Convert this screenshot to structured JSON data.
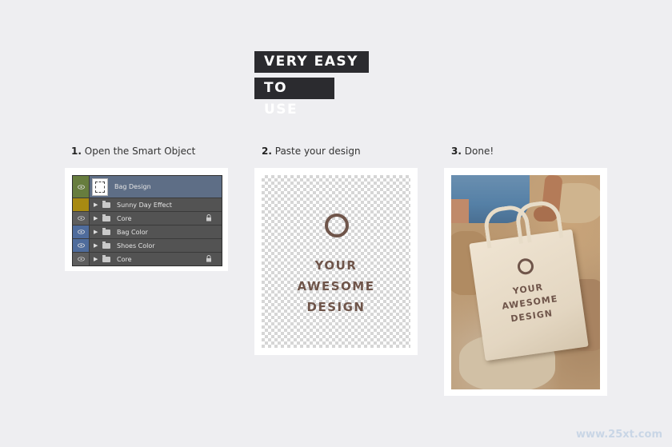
{
  "header": {
    "line1": "VERY EASY",
    "line2": "TO USE"
  },
  "steps": [
    {
      "number": "1.",
      "label": "Open the Smart Object"
    },
    {
      "number": "2.",
      "label": "Paste your design"
    },
    {
      "number": "3.",
      "label": "Done!"
    }
  ],
  "layers_panel": {
    "layers": [
      {
        "name": "Bag Design",
        "eye_color": "green",
        "type": "smart-object"
      },
      {
        "name": "Sunny Day Effect",
        "eye_color": "yellow",
        "type": "group"
      },
      {
        "name": "Core",
        "eye_color": "gray",
        "type": "group",
        "locked": true
      },
      {
        "name": "Bag Color",
        "eye_color": "blue",
        "type": "group"
      },
      {
        "name": "Shoes Color",
        "eye_color": "blue",
        "type": "group"
      },
      {
        "name": "Core",
        "eye_color": "gray",
        "type": "group",
        "locked": true
      }
    ]
  },
  "design": {
    "line1": "YOUR",
    "line2": "AWESOME",
    "line3": "DESIGN"
  },
  "bag_print": {
    "line1": "YOUR",
    "line2": "AWESOME",
    "line3": "DESIGN"
  },
  "watermark": "www.25xt.com",
  "colors": {
    "background": "#eeeef1",
    "title_bar": "#2b2b2f",
    "design_brown": "#6f554a",
    "eye_green": "#677d3e",
    "eye_yellow": "#a88a12",
    "eye_blue": "#4f6c9c"
  }
}
